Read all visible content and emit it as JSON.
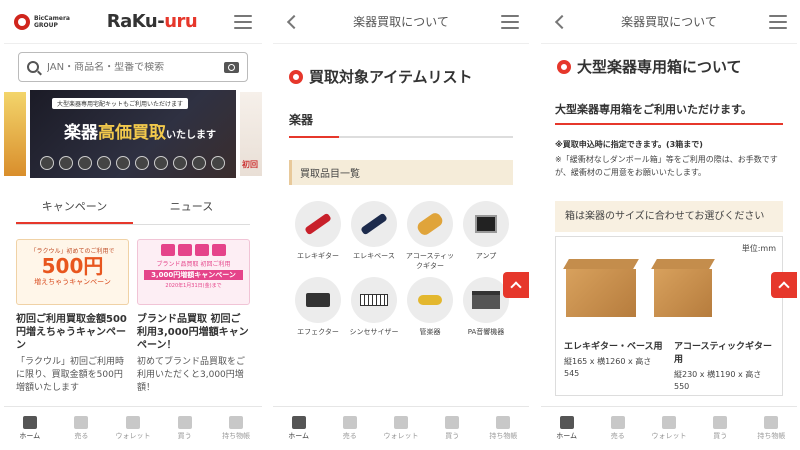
{
  "screen1": {
    "brand_line1": "BicCamera",
    "brand_line2": "GROUP",
    "logo_main": "RaKu-",
    "logo_accent": "uru",
    "search": {
      "placeholder": "JAN・商品名・型番で検索"
    },
    "banner": {
      "subtitle": "大型楽器専用宅配キットもご利用いただけます",
      "title_a": "楽器",
      "title_b": "高価買取",
      "title_c": "いたします",
      "right_peek": "初回"
    },
    "tabs": [
      "キャンペーン",
      "ニュース"
    ],
    "cards": [
      {
        "img_top": "「ラクウル」初めてのご利用で",
        "img_big": "500円",
        "img_small": "増えちゃうキャンペーン",
        "title": "初回ご利用買取金額500円増えちゃうキャンペーン",
        "desc": "「ラクウル」初回ご利用時に限り、買取金額を500円増額いたします"
      },
      {
        "img_top": "ブランド品買取 初回ご利用",
        "img_big": "3,000円増額キャンペーン",
        "img_small": "2020年1月31日(金)まで",
        "title": "ブランド品買取 初回ご利用3,000円増額キャンペーン！",
        "desc": "初めてブランド品買取をご利用いただくと3,000円増額！"
      }
    ]
  },
  "nav": {
    "items": [
      "ホーム",
      "売る",
      "ウォレット",
      "買う",
      "持ち物帳"
    ],
    "active_index": 0
  },
  "screen2": {
    "bar_title": "楽器買取について",
    "section_title": "買取対象アイテムリスト",
    "sub_tab": "楽器",
    "list_header": "買取品目一覧",
    "items": [
      {
        "label": "エレキギター",
        "icon": "electric-guitar-icon"
      },
      {
        "label": "エレキベース",
        "icon": "electric-bass-icon"
      },
      {
        "label": "アコースティックギター",
        "icon": "acoustic-guitar-icon"
      },
      {
        "label": "アンプ",
        "icon": "amp-icon"
      },
      {
        "label": "エフェクター",
        "icon": "effector-icon"
      },
      {
        "label": "シンセサイザー",
        "icon": "synthesizer-icon"
      },
      {
        "label": "管楽器",
        "icon": "wind-instrument-icon"
      },
      {
        "label": "PA音響機器",
        "icon": "pa-equipment-icon"
      }
    ]
  },
  "screen3": {
    "bar_title": "楽器買取について",
    "section_title": "大型楽器専用箱について",
    "lead": "大型楽器専用箱をご利用いただけます。",
    "note1": "※買取申込時に指定できます。(3箱まで)",
    "note2": "※「緩衝材なしダンボール箱」等をご利用の際は、お手数ですが、緩衝材のご用意をお願いいたします。",
    "select_text": "箱は楽器のサイズに合わせてお選びください",
    "unit": "単位:mm",
    "boxes": [
      {
        "name": "エレキギター・ベース用",
        "dims": "縦165 x 横1260 x 高さ545"
      },
      {
        "name": "アコースティックギター用",
        "dims": "縦230 x 横1190 x 高さ550"
      }
    ]
  },
  "colors": {
    "accent": "#e6372b",
    "beige": "#f5ecd9",
    "text": "#333333"
  }
}
